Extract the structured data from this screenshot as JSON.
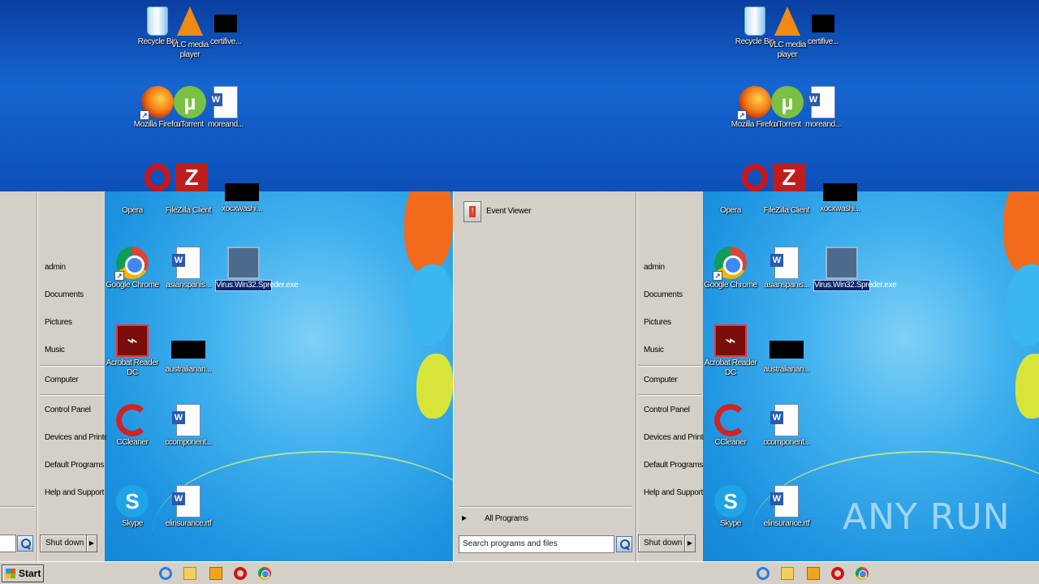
{
  "desktop_top": {
    "icons": [
      {
        "label": "Recycle Bin"
      },
      {
        "label": "VLC media player"
      },
      {
        "label": "certifive..."
      },
      {
        "label": "Mozilla Firefox"
      },
      {
        "label": "uTorrent"
      },
      {
        "label": "moreand..."
      }
    ]
  },
  "desktop_left": {
    "icons": [
      {
        "label": "Opera"
      },
      {
        "label": "FileZilla Client"
      },
      {
        "label": "xocxwashi..."
      },
      {
        "label": "Google Chrome"
      },
      {
        "label": "asianspanis..."
      },
      {
        "label": "Virus.Win32.Spreder.exe"
      },
      {
        "label": "Acrobat Reader DC"
      },
      {
        "label": "australianan..."
      },
      {
        "label": "CCleaner"
      },
      {
        "label": "ccomponent..."
      },
      {
        "label": "Skype"
      },
      {
        "label": "elinsurance.rtf"
      }
    ]
  },
  "start_menu": {
    "right_items": [
      "admin",
      "Documents",
      "Pictures",
      "Music",
      "Computer",
      "Control Panel",
      "Devices and Printers",
      "Default Programs",
      "Help and Support"
    ],
    "shutdown_label": "Shut down",
    "all_programs": "All Programs",
    "search_placeholder": "Search programs and files",
    "program_item": "Event Viewer"
  },
  "taskbar": {
    "start_label": "Start",
    "icons": [
      "internet-explorer-icon",
      "folder-icon",
      "media-player-icon",
      "opera-icon",
      "chrome-icon"
    ]
  },
  "watermark": "ANY RUN",
  "colors": {
    "menu_bg": "#d4d0c8",
    "wallpaper_blue": "#1565d0",
    "selection": "#0a246a"
  }
}
